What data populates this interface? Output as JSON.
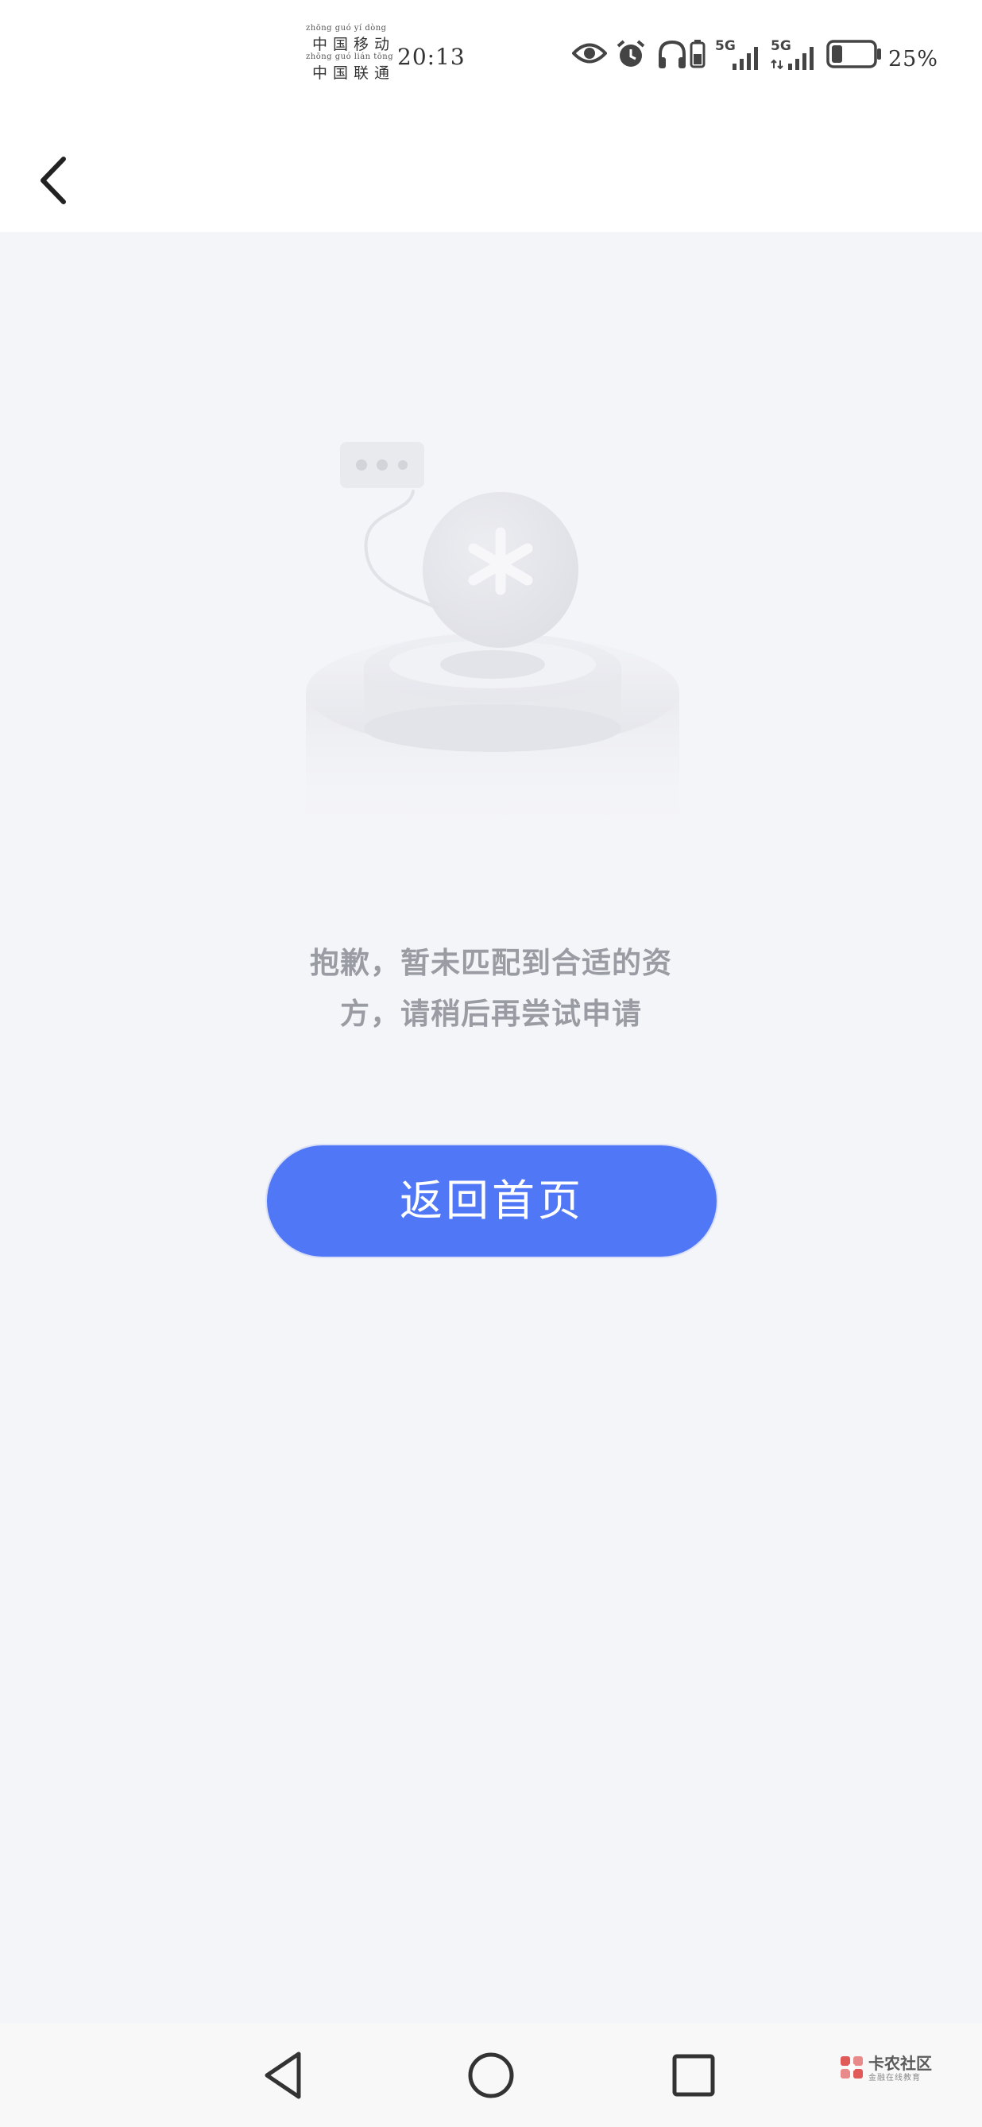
{
  "status_bar": {
    "carrier_1": {
      "pinyin": "zhōng guó  yí  dòng",
      "name": "中国移动"
    },
    "carrier_2": {
      "pinyin": "zhōng guó  lián  tōng",
      "name": "中国联通"
    },
    "time": "20:13",
    "network_1": "5G",
    "network_2": "5G",
    "battery_percent": "25%",
    "battery_level": 0.25,
    "icons": [
      "eye-comfort-icon",
      "alarm-icon",
      "headphones-icon",
      "vibrate-battery-icon",
      "signal-5g-icon",
      "signal-5g-icon",
      "battery-icon"
    ]
  },
  "nav": {
    "back_icon": "chevron-left-icon"
  },
  "main": {
    "illustration": "empty-match-illustration",
    "message_line_1": "抱歉，暂未匹配到合适的资",
    "message_line_2": "方，请稍后再尝试申请",
    "home_button_label": "返回首页",
    "accent_color": "#5077f6"
  },
  "system_nav": {
    "back_icon": "triangle-back-icon",
    "home_icon": "circle-home-icon",
    "recents_icon": "square-recents-icon"
  },
  "watermark": {
    "title": "卡农社区",
    "subtitle": "金融在线教育"
  }
}
